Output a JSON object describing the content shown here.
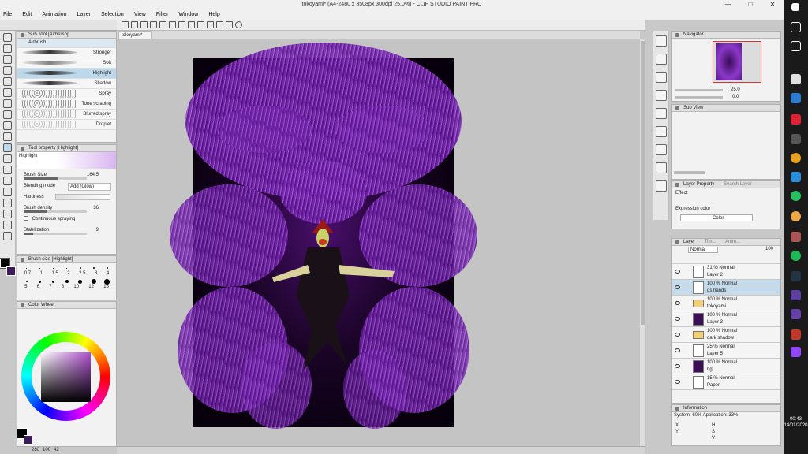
{
  "window": {
    "title": "tokoyami* (A4-2480 x 3508px 300dpi 25.0%) - CLIP STUDIO PAINT PRO",
    "controls": [
      "—",
      "□",
      "✕"
    ]
  },
  "menu": [
    "File",
    "Edit",
    "Animation",
    "Layer",
    "Selection",
    "View",
    "Filter",
    "Window",
    "Help"
  ],
  "subtool": {
    "title": "Sub Tool [Airbrush]",
    "group": "Airbrush",
    "brushes": [
      "Stronger",
      "Soft",
      "Highlight",
      "Shadow",
      "Spray",
      "Tone scraping",
      "Blurred spray",
      "Droplet"
    ],
    "selected": "Highlight"
  },
  "tool_property": {
    "title": "Tool property [Highlight]",
    "tool_name": "Highlight",
    "brush_size_label": "Brush Size",
    "brush_size_value": "164.5",
    "blending_label": "Blending mode",
    "blending_value": "Add (Glow)",
    "hardness_label": "Hardness",
    "density_label": "Brush density",
    "density_value": "36",
    "continuous_label": "Continuous spraying",
    "stabilization_label": "Stabilization",
    "stabilization_value": "9",
    "brush_size_fill": 0.55,
    "density_fill": 0.36,
    "stabilization_fill": 0.15
  },
  "brush_size_panel": {
    "title": "Brush size [Highlight]",
    "row1": [
      "0.7",
      "1",
      "1.5",
      "2",
      "2.5",
      "3",
      "4"
    ],
    "row2": [
      "5",
      "6",
      "7",
      "8",
      "10",
      "12",
      "15"
    ]
  },
  "color_wheel": {
    "title": "Color Wheel",
    "readout": [
      "280",
      "100",
      "42"
    ]
  },
  "document_tab": "tokoyami*",
  "navigator": {
    "title": "Navigator",
    "zoom": "25.0",
    "rotation": "0.0"
  },
  "sub_view": {
    "title": "Sub View"
  },
  "layer_property": {
    "title": "Layer Property",
    "search_tab": "Search Layer",
    "effect_label": "Effect",
    "expression_label": "Expression color",
    "expression_value": "Color"
  },
  "layer_panel": {
    "title": "Layer",
    "tabs": [
      "Tim...",
      "Anim..."
    ],
    "blend_mode": "Normal",
    "opacity": "100",
    "layers": [
      {
        "opacity": "31 % Normal",
        "name": "Layer 2",
        "selected": false,
        "folder": false
      },
      {
        "opacity": "100 % Normal",
        "name": "ds hands",
        "selected": true,
        "folder": false
      },
      {
        "opacity": "100 % Normal",
        "name": "tokoyami",
        "selected": false,
        "folder": true
      },
      {
        "opacity": "100 % Normal",
        "name": "Layer 3",
        "selected": false,
        "folder": false
      },
      {
        "opacity": "100 % Normal",
        "name": "dark shadow",
        "selected": false,
        "folder": true
      },
      {
        "opacity": "25 % Normal",
        "name": "Layer 5",
        "selected": false,
        "folder": false
      },
      {
        "opacity": "100 % Normal",
        "name": "bg",
        "selected": false,
        "folder": false
      },
      {
        "opacity": "15 % Normal",
        "name": "Paper",
        "selected": false,
        "folder": false
      }
    ]
  },
  "information": {
    "title": "Information",
    "system": "System: 60% Application: 33%",
    "coords": [
      "X",
      "Y",
      "H",
      "S",
      "V"
    ]
  },
  "taskbar": {
    "time": "00:43",
    "date": "14/01/2020"
  },
  "colors": {
    "accent": "#a74fe0",
    "selection": "#bcd8ea",
    "foreground": "#000000",
    "background": "#3a1a5a"
  }
}
